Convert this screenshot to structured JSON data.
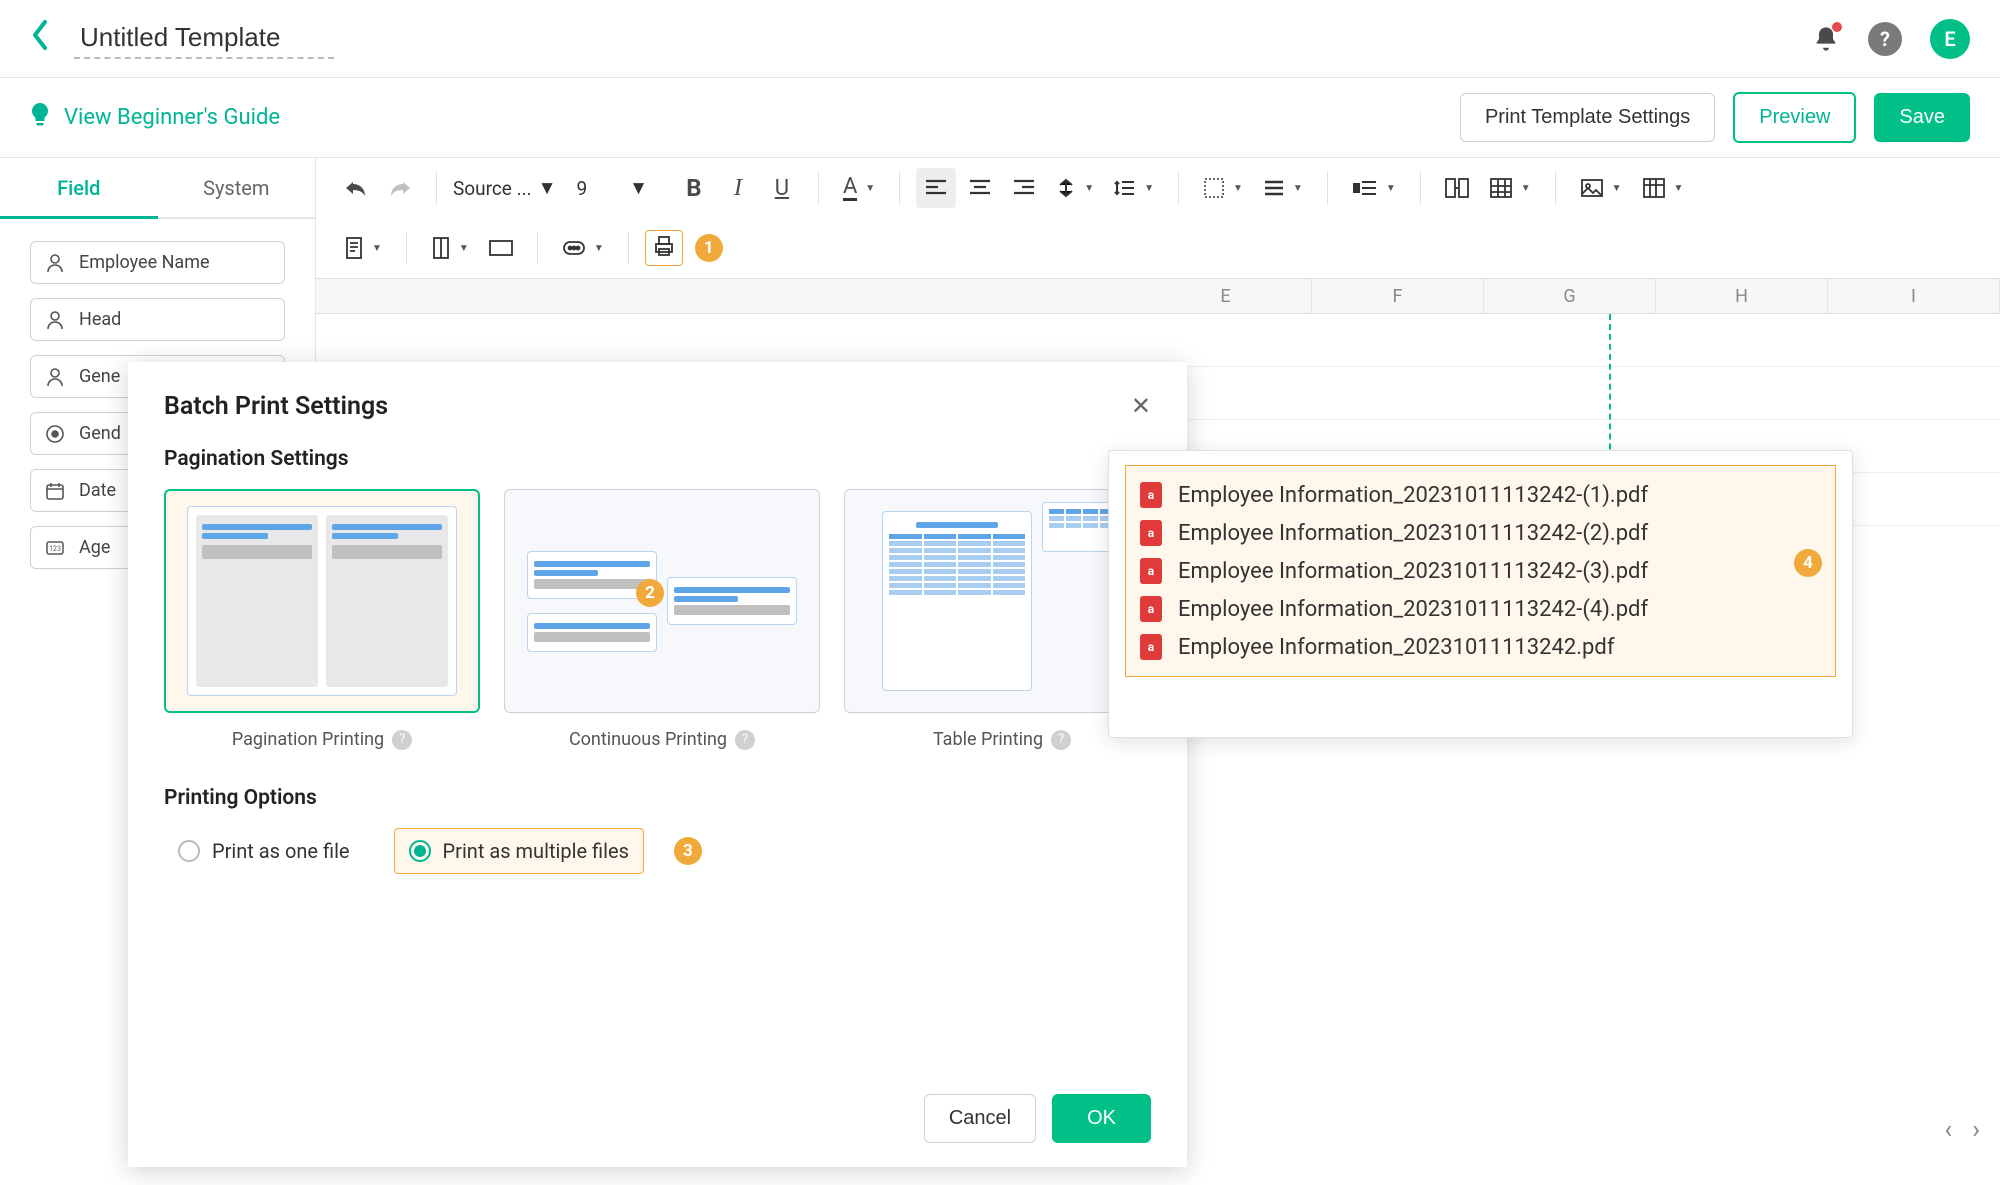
{
  "header": {
    "title_value": "Untitled Template",
    "avatar_letter": "E"
  },
  "subheader": {
    "guide_label": "View Beginner's Guide",
    "settings_btn": "Print Template Settings",
    "preview_btn": "Preview",
    "save_btn": "Save"
  },
  "sidebar": {
    "tabs": {
      "field": "Field",
      "system": "System"
    },
    "fields": [
      {
        "icon": "person",
        "label": "Employee Name"
      },
      {
        "icon": "person",
        "label": "Head"
      },
      {
        "icon": "person",
        "label": "Gene"
      },
      {
        "icon": "radio",
        "label": "Gend"
      },
      {
        "icon": "date",
        "label": "Date"
      },
      {
        "icon": "num",
        "label": "Age"
      }
    ]
  },
  "toolbar": {
    "font_name": "Source ...",
    "font_size": "9"
  },
  "columns": [
    "E",
    "F",
    "G",
    "H",
    "I"
  ],
  "modal": {
    "title": "Batch Print Settings",
    "pagination_heading": "Pagination Settings",
    "cards": [
      {
        "label": "Pagination Printing"
      },
      {
        "label": "Continuous Printing"
      },
      {
        "label": "Table Printing"
      }
    ],
    "options_heading": "Printing Options",
    "opt_one": "Print as one file",
    "opt_multi": "Print as multiple files",
    "cancel": "Cancel",
    "ok": "OK"
  },
  "callouts": {
    "c1": "1",
    "c2": "2",
    "c3": "3",
    "c4": "4"
  },
  "popover": {
    "files": [
      "Employee Information_20231011113242-(1).pdf",
      "Employee Information_20231011113242-(2).pdf",
      "Employee Information_20231011113242-(3).pdf",
      "Employee Information_20231011113242-(4).pdf",
      "Employee Information_20231011113242.pdf"
    ]
  }
}
